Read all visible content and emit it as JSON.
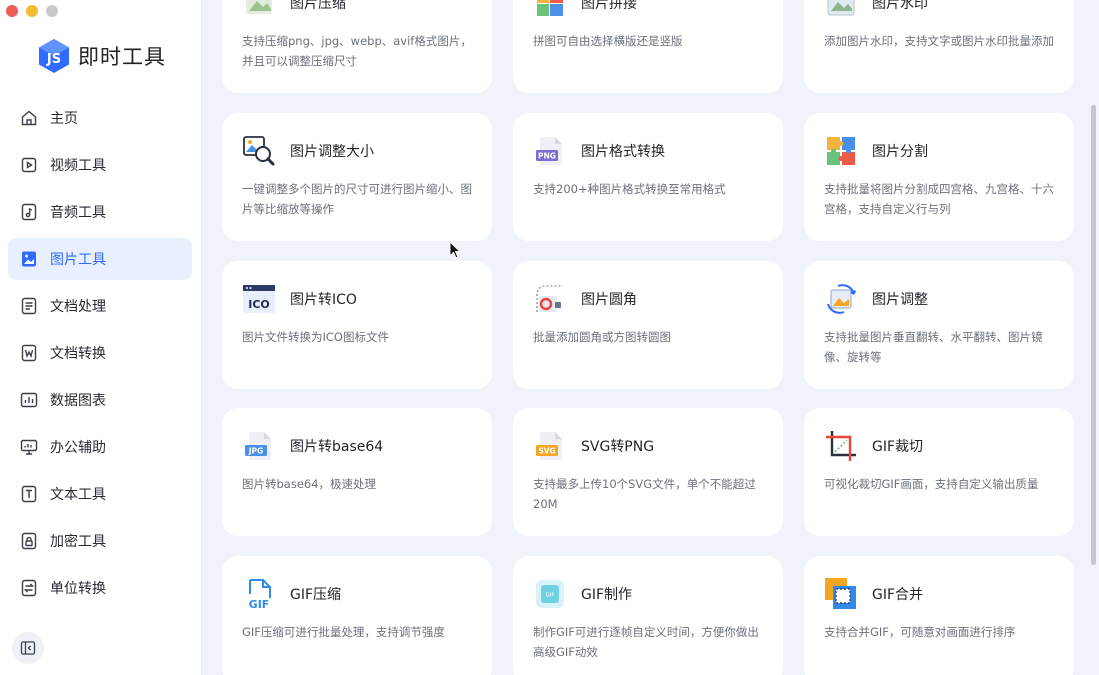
{
  "brand": {
    "name": "即时工具",
    "logo": "js-logo"
  },
  "nav": [
    {
      "label": "主页",
      "icon": "home-icon"
    },
    {
      "label": "视频工具",
      "icon": "video-icon"
    },
    {
      "label": "音频工具",
      "icon": "audio-icon"
    },
    {
      "label": "图片工具",
      "icon": "image-icon",
      "active": true
    },
    {
      "label": "文档处理",
      "icon": "document-icon"
    },
    {
      "label": "文档转换",
      "icon": "word-icon"
    },
    {
      "label": "数据图表",
      "icon": "chart-icon"
    },
    {
      "label": "办公辅助",
      "icon": "monitor-icon"
    },
    {
      "label": "文本工具",
      "icon": "text-icon"
    },
    {
      "label": "加密工具",
      "icon": "lock-icon"
    },
    {
      "label": "单位转换",
      "icon": "convert-icon"
    }
  ],
  "cards": [
    {
      "title": "图片压缩",
      "desc": "支持压缩png、jpg、webp、avif格式图片，并且可以调整压缩尺寸",
      "icon": "image-compress-icon"
    },
    {
      "title": "图片拼接",
      "desc": "拼图可自由选择横版还是竖版",
      "icon": "image-stitch-icon"
    },
    {
      "title": "图片水印",
      "desc": "添加图片水印，支持文字或图片水印批量添加",
      "icon": "image-watermark-icon"
    },
    {
      "title": "图片调整大小",
      "desc": "一键调整多个图片的尺寸可进行图片缩小、图片等比缩放等操作",
      "icon": "image-resize-icon"
    },
    {
      "title": "图片格式转换",
      "desc": "支持200+种图片格式转换至常用格式",
      "icon": "png-file-icon",
      "icon_text": "PNG"
    },
    {
      "title": "图片分割",
      "desc": "支持批量将图片分割成四宫格、九宫格、十六宫格，支持自定义行与列",
      "icon": "puzzle-icon"
    },
    {
      "title": "图片转ICO",
      "desc": "图片文件转换为ICO图标文件",
      "icon": "ico-icon",
      "icon_text": "ICO"
    },
    {
      "title": "图片圆角",
      "desc": "批量添加圆角或方图转圆图",
      "icon": "round-corner-icon"
    },
    {
      "title": "图片调整",
      "desc": "支持批量图片垂直翻转、水平翻转、图片镜像、旋转等",
      "icon": "image-rotate-icon"
    },
    {
      "title": "图片转base64",
      "desc": "图片转base64，极速处理",
      "icon": "jpg-file-icon",
      "icon_text": "JPG"
    },
    {
      "title": "SVG转PNG",
      "desc": "支持最多上传10个SVG文件，单个不能超过20M",
      "icon": "svg-file-icon",
      "icon_text": "SVG"
    },
    {
      "title": "GIF裁切",
      "desc": "可视化裁切GIF画面，支持自定义输出质量",
      "icon": "crop-icon"
    },
    {
      "title": "GIF压缩",
      "desc": "GIF压缩可进行批量处理，支持调节强度",
      "icon": "gif-file-icon",
      "icon_text": "GIF"
    },
    {
      "title": "GIF制作",
      "desc": "制作GIF可进行逐帧自定义时间，方便你做出高级GIF动效",
      "icon": "gif-make-icon",
      "icon_text": "GIF"
    },
    {
      "title": "GIF合并",
      "desc": "支持合并GIF，可随意对画面进行排序",
      "icon": "gif-merge-icon"
    }
  ]
}
